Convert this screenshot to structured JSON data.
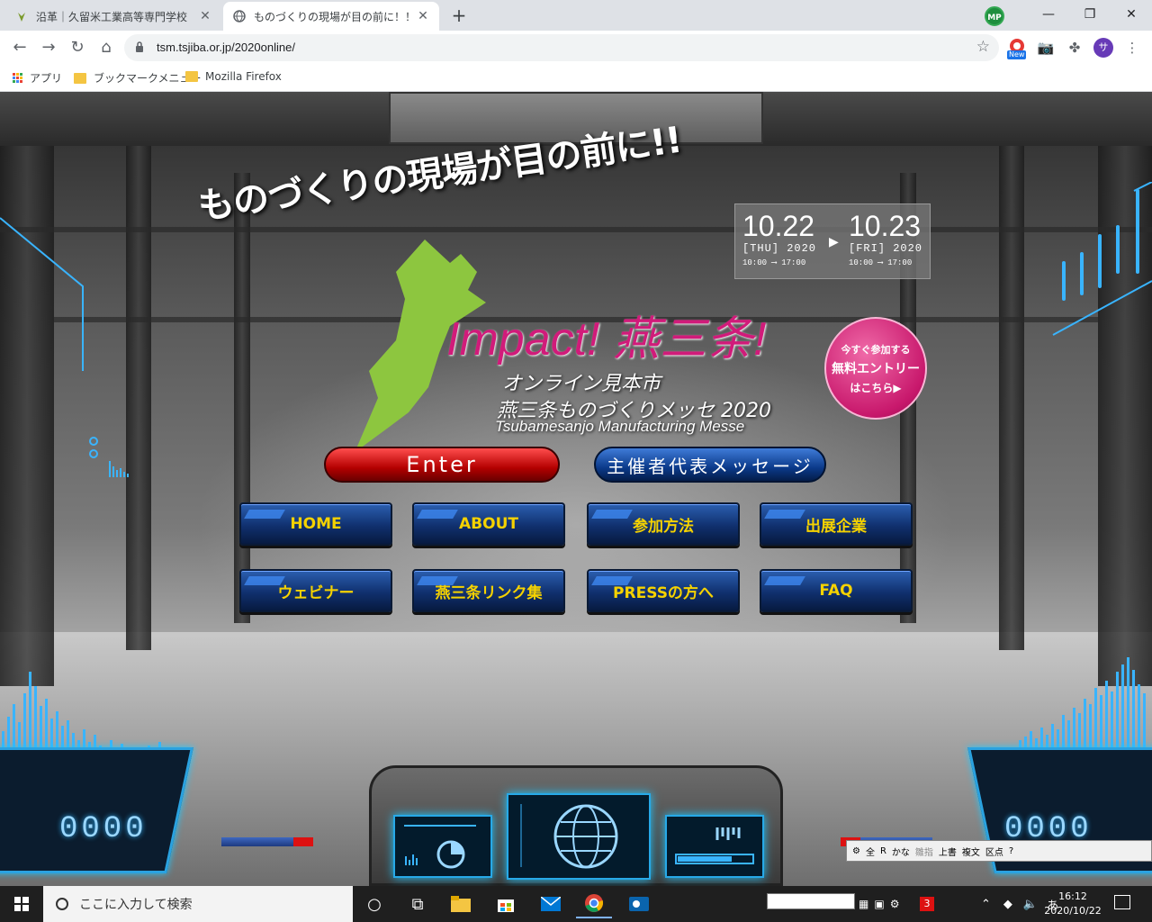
{
  "browser": {
    "tabs": [
      {
        "title": "沿革｜久留米工業高等専門学校",
        "active": false
      },
      {
        "title": "ものづくりの現場が目の前に！！ | 燕",
        "active": true
      }
    ],
    "url": "tsm.tsjiba.or.jp/2020online/",
    "new_badge": "New",
    "profile_mp": "MP",
    "profile_s": "サ",
    "bookmarks": [
      "アプリ",
      "ブックマークメニュー",
      "Mozilla Firefox"
    ]
  },
  "page": {
    "catchcopy": "ものづくりの現場が目の前に!!",
    "dates": {
      "start_date": "10.22",
      "start_day": "[THU] 2020",
      "start_time": "10:00 ⟶ 17:00",
      "end_date": "10.23",
      "end_day": "[FRI] 2020",
      "end_time": "10:00 ⟶ 17:00"
    },
    "logo_text": "Impact! 燕三条!",
    "subtitle_1": "オンライン見本市",
    "subtitle_2": "燕三条ものづくりメッセ 2020",
    "subtitle_3": "Tsubamesanjo Manufacturing Messe",
    "entry": {
      "line1": "今すぐ参加する",
      "line2": "無料エントリー",
      "line3": "はこちら▶"
    },
    "enter_button": "Enter",
    "message_button": "主催者代表メッセージ",
    "nav": [
      "HOME",
      "ABOUT",
      "参加方法",
      "出展企業",
      "ウェビナー",
      "燕三条リンク集",
      "PRESSの方へ",
      "FAQ"
    ],
    "hud_left_digits": "0000",
    "hud_right_digits": "0000"
  },
  "ime_bar": {
    "items": [
      "全",
      "R",
      "かな",
      "雛指",
      "上書",
      "複文",
      "区点"
    ]
  },
  "taskbar": {
    "search_placeholder": "ここに入力して検索",
    "notification_count": "3",
    "time": "16:12",
    "date": "2020/10/22",
    "ime_mode": "あ"
  },
  "colors": {
    "accent_magenta": "#d11b7a",
    "logo_green": "#8dc63f",
    "nav_text": "#f5d200",
    "hud_cyan": "#39b4ff"
  }
}
